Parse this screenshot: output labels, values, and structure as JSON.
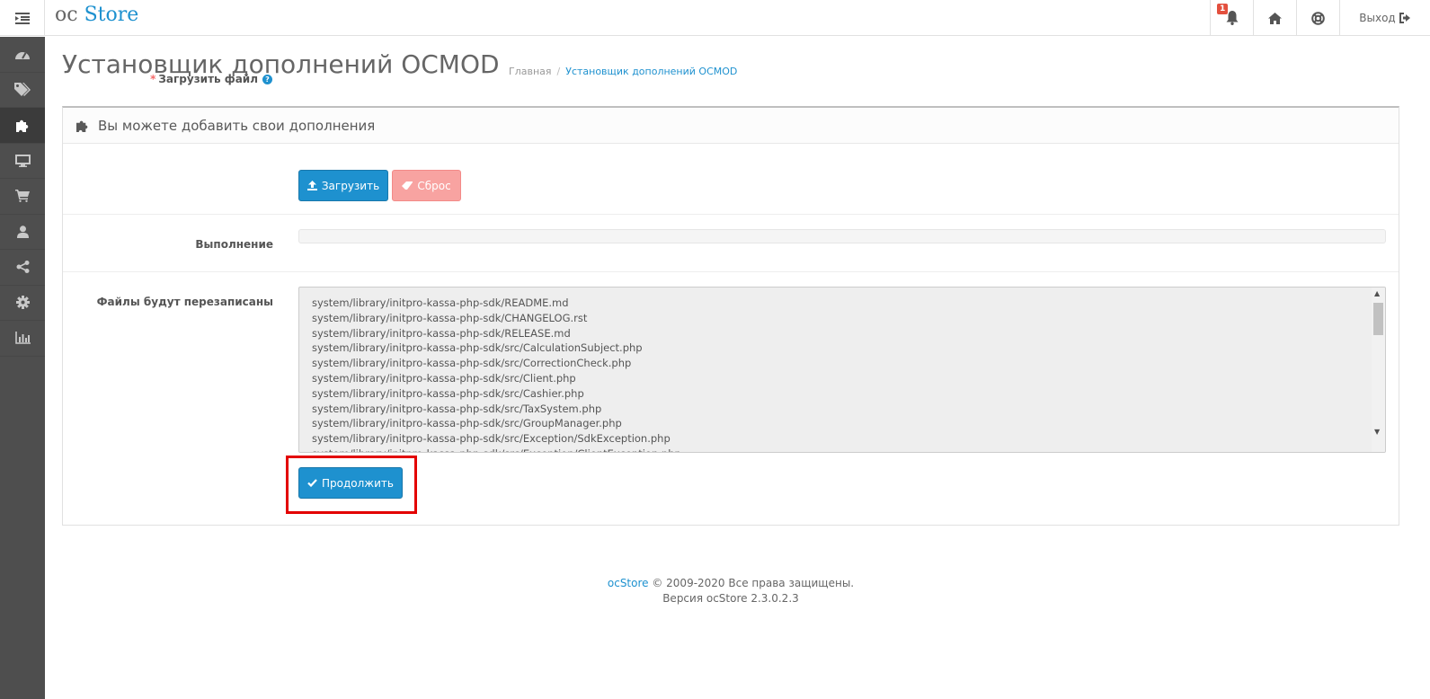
{
  "header": {
    "logo_prefix": "oc",
    "logo_brand": "Store",
    "notification_count": "1",
    "logout_label": "Выход"
  },
  "page": {
    "title": "Установщик дополнений OCMOD",
    "breadcrumb_home": "Главная",
    "breadcrumb_sep": "/",
    "breadcrumb_current": "Установщик дополнений OCMOD"
  },
  "panel": {
    "title": "Вы можете добавить свои дополнения",
    "upload_label_required": "*",
    "upload_label": "Загрузить файл",
    "upload_help": "?",
    "upload_button": "Загрузить",
    "reset_button": "Сброс",
    "progress_label": "Выполнение",
    "progress_value": 0,
    "files_label": "Файлы будут перезаписаны",
    "files": [
      "system/library/initpro-kassa-php-sdk/README.md",
      "system/library/initpro-kassa-php-sdk/CHANGELOG.rst",
      "system/library/initpro-kassa-php-sdk/RELEASE.md",
      "system/library/initpro-kassa-php-sdk/src/CalculationSubject.php",
      "system/library/initpro-kassa-php-sdk/src/CorrectionCheck.php",
      "system/library/initpro-kassa-php-sdk/src/Client.php",
      "system/library/initpro-kassa-php-sdk/src/Cashier.php",
      "system/library/initpro-kassa-php-sdk/src/TaxSystem.php",
      "system/library/initpro-kassa-php-sdk/src/GroupManager.php",
      "system/library/initpro-kassa-php-sdk/src/Exception/SdkException.php",
      "system/library/initpro-kassa-php-sdk/src/Exception/ClientException.php"
    ],
    "continue_button": "Продолжить"
  },
  "footer": {
    "brand_link": "ocStore",
    "copyright": " © 2009-2020 Все права защищены.",
    "version": "Версия ocStore 2.3.0.2.3"
  },
  "colors": {
    "primary": "#1e91cf",
    "danger_light": "#f8a3a1",
    "sidebar_bg": "#4e4e4e",
    "highlight": "#e30000"
  },
  "icons": {
    "menu": "menu-toggle-icon",
    "notifications": "bell-icon",
    "home": "home-icon",
    "help": "life-ring-icon",
    "logout": "sign-out-icon",
    "sidebar": [
      "dashboard-icon",
      "tags-icon",
      "puzzle-icon",
      "desktop-icon",
      "cart-icon",
      "user-icon",
      "share-icon",
      "cog-icon",
      "bar-chart-icon"
    ]
  }
}
